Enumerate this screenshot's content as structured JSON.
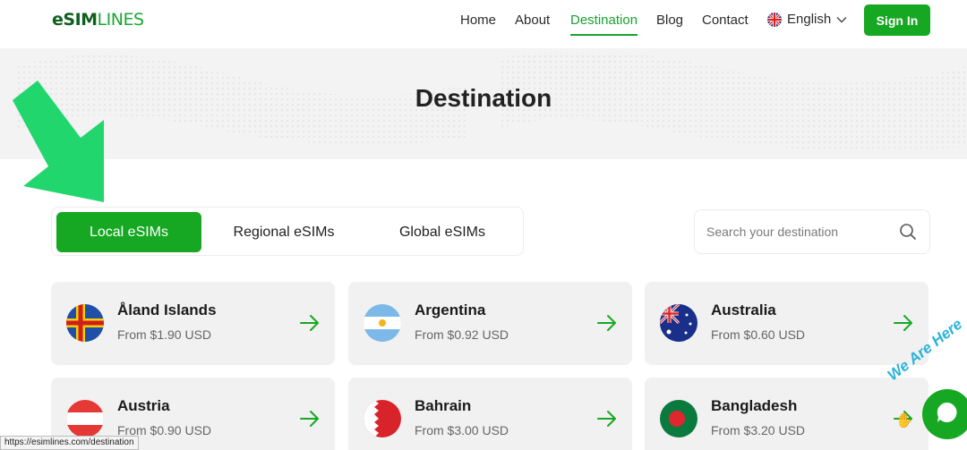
{
  "brand": {
    "logo_part1": "eSIM",
    "logo_part2": "LINES"
  },
  "nav": {
    "home": "Home",
    "about": "About",
    "destination": "Destination",
    "blog": "Blog",
    "contact": "Contact"
  },
  "language": {
    "label": "English"
  },
  "signin": {
    "label": "Sign In"
  },
  "hero": {
    "title": "Destination"
  },
  "tabs": [
    {
      "label": "Local eSIMs"
    },
    {
      "label": "Regional eSIMs"
    },
    {
      "label": "Global eSIMs"
    }
  ],
  "search": {
    "placeholder": "Search your destination"
  },
  "destinations": [
    {
      "name": "Åland Islands",
      "price": "From $1.90 USD"
    },
    {
      "name": "Argentina",
      "price": "From $0.92 USD"
    },
    {
      "name": "Australia",
      "price": "From $0.60 USD"
    },
    {
      "name": "Austria",
      "price": "From $0.90 USD"
    },
    {
      "name": "Bahrain",
      "price": "From $3.00 USD"
    },
    {
      "name": "Bangladesh",
      "price": "From $3.20 USD"
    }
  ],
  "status_url": "https://esimlines.com/destination",
  "chat": {
    "label": "We Are Here"
  },
  "colors": {
    "accent": "#16a822",
    "annotation_arrow": "#22d66e"
  }
}
